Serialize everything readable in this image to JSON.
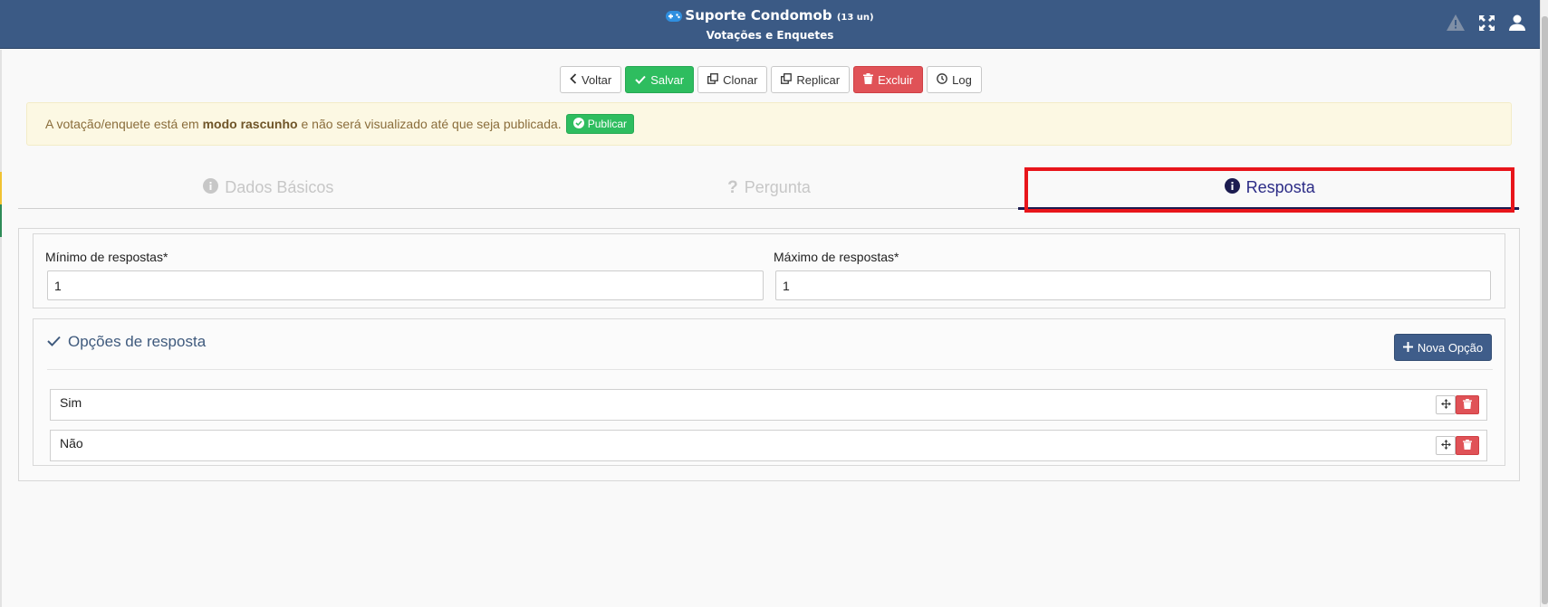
{
  "header": {
    "title": "Suporte Condomob",
    "units": "(13 un)",
    "subtitle": "Votações e Enquetes",
    "icons": [
      "warning-icon",
      "expand-icon",
      "user-icon"
    ]
  },
  "toolbar": {
    "back_label": "Voltar",
    "save_label": "Salvar",
    "clone_label": "Clonar",
    "replicate_label": "Replicar",
    "delete_label": "Excluir",
    "log_label": "Log"
  },
  "alert": {
    "prefix": "A votação/enquete está em",
    "bold": "modo rascunho",
    "suffix": "e não será visualizado até que seja publicada.",
    "publish_label": "Publicar"
  },
  "tabs": [
    {
      "label": "Dados Básicos",
      "active": false
    },
    {
      "label": "Pergunta",
      "active": false
    },
    {
      "label": "Resposta",
      "active": true
    }
  ],
  "form": {
    "min_label": "Mínimo de respostas*",
    "min_value": "1",
    "max_label": "Máximo de respostas*",
    "max_value": "1"
  },
  "options": {
    "title": "Opções de resposta",
    "new_label": "Nova Opção",
    "items": [
      {
        "label": "Sim"
      },
      {
        "label": "Não"
      }
    ]
  },
  "colors": {
    "header": "#3b5a85",
    "success": "#2ebd5f",
    "danger": "#e05257",
    "active_tab": "#2b2b86",
    "highlight": "#e8151b"
  }
}
